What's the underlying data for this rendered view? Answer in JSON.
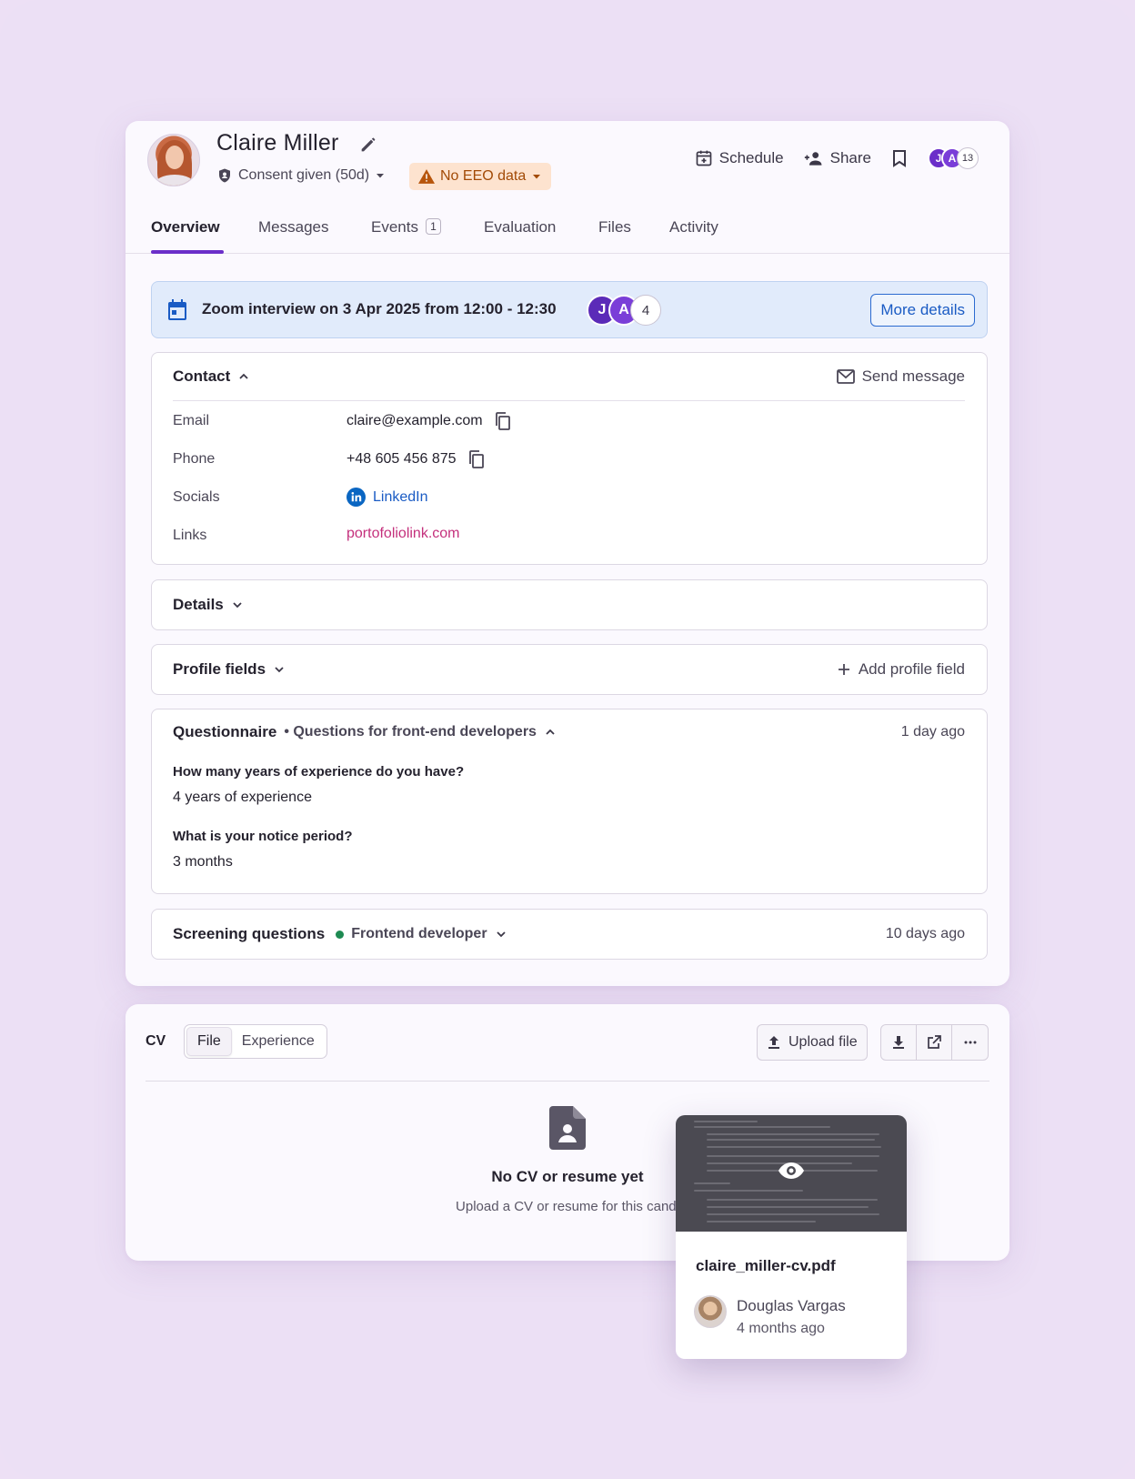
{
  "candidate": {
    "name": "Claire Miller",
    "consent": "Consent given (50d)",
    "eeo_badge": "No EEO data"
  },
  "header": {
    "schedule": "Schedule",
    "share": "Share",
    "watchers": [
      {
        "initial": "J",
        "color": "#6b2fc9"
      },
      {
        "initial": "A",
        "color": "#7a3ed8"
      }
    ],
    "watchers_count": "13"
  },
  "tabs": [
    {
      "label": "Overview",
      "active": true
    },
    {
      "label": "Messages"
    },
    {
      "label": "Events",
      "badge": "1"
    },
    {
      "label": "Evaluation"
    },
    {
      "label": "Files"
    },
    {
      "label": "Activity"
    }
  ],
  "interview": {
    "text": "Zoom interview on 3 Apr 2025 from 12:00 - 12:30",
    "attendees": [
      {
        "initial": "J",
        "color": "#5b2bb8"
      },
      {
        "initial": "A",
        "color": "#7a3ed8"
      }
    ],
    "more_count": "4",
    "more_details": "More details"
  },
  "contact": {
    "title": "Contact",
    "send_message": "Send message",
    "rows": [
      {
        "label": "Email",
        "value": "claire@example.com"
      },
      {
        "label": "Phone",
        "value": "+48 605 456 875"
      },
      {
        "label": "Socials",
        "value": "LinkedIn"
      },
      {
        "label": "Links",
        "value": "portofoliolink.com"
      }
    ]
  },
  "details": {
    "title": "Details"
  },
  "profile_fields": {
    "title": "Profile fields",
    "add": "Add profile field"
  },
  "questionnaire": {
    "title": "Questionnaire",
    "subtitle": "• Questions for front-end developers",
    "time": "1 day ago",
    "items": [
      {
        "question": "How many years of experience do you have?",
        "answer": "4 years of experience"
      },
      {
        "question": "What is your notice period?",
        "answer": "3 months"
      }
    ]
  },
  "screening": {
    "title": "Screening questions",
    "role": "Frontend developer",
    "time": "10 days ago",
    "status_color": "#1e8a52"
  },
  "cv": {
    "label": "CV",
    "tabs": [
      "File",
      "Experience"
    ],
    "upload": "Upload file",
    "empty_title": "No CV or resume yet",
    "empty_sub": "Upload a CV or resume for this candi"
  },
  "file_popup": {
    "filename": "claire_miller-cv.pdf",
    "uploader": "Douglas Vargas",
    "time": "4 months ago"
  },
  "colors": {
    "accent": "#6b2fc9",
    "link": "#1a5bc4",
    "warning_bg": "#fde3cf",
    "warning_text": "#a24a06"
  }
}
